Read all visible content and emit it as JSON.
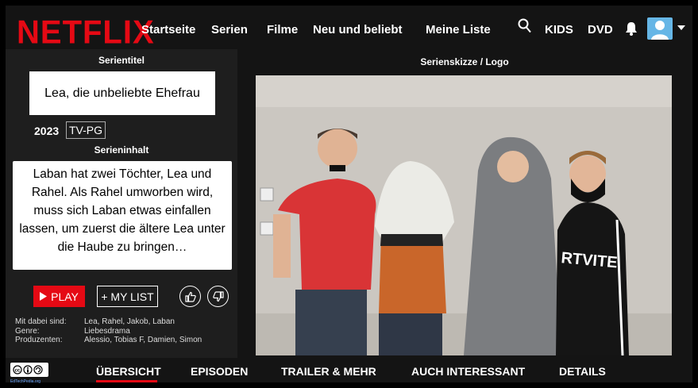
{
  "brand": {
    "name": "NETFLIX",
    "color": "#e50914"
  },
  "nav": {
    "items": [
      "Startseite",
      "Serien",
      "Filme",
      "Neu und beliebt",
      "Meine Liste"
    ],
    "kids": "KIDS",
    "dvd": "DVD",
    "icons": [
      "search-icon",
      "bell-icon",
      "avatar",
      "chevron-down-icon"
    ]
  },
  "left": {
    "title_label": "Serientitel",
    "title": "Lea, die unbeliebte Ehefrau",
    "year": "2023",
    "rating": "TV-PG",
    "content_label": "Serieninhalt",
    "description": "Laban hat zwei Töchter, Lea und Rahel. Als Rahel umworben wird, muss sich Laban etwas einfallen lassen, um zuerst die ältere Lea unter die Haube zu bringen…",
    "play": "PLAY",
    "my_list": "+ MY LIST",
    "credits": [
      {
        "key": "Mit dabei sind:",
        "value": "Lea, Rahel, Jakob, Laban"
      },
      {
        "key": "Genre:",
        "value": "Liebesdrama"
      },
      {
        "key": "Produzenten:",
        "value": "Alessio, Tobias F, Damien, Simon"
      }
    ]
  },
  "right": {
    "sketch_label": "Serienskizze / Logo"
  },
  "tabs": {
    "items": [
      "ÜBERSICHT",
      "EPISODEN",
      "TRAILER & MEHR",
      "AUCH INTERESSANT",
      "DETAILS"
    ],
    "active": "ÜBERSICHT"
  },
  "license": {
    "badge": "cc by sa",
    "caption": "EdTechPedia.org"
  },
  "colors": {
    "accent": "#e50914",
    "background": "#141414",
    "panel": "#1e1e1e"
  }
}
